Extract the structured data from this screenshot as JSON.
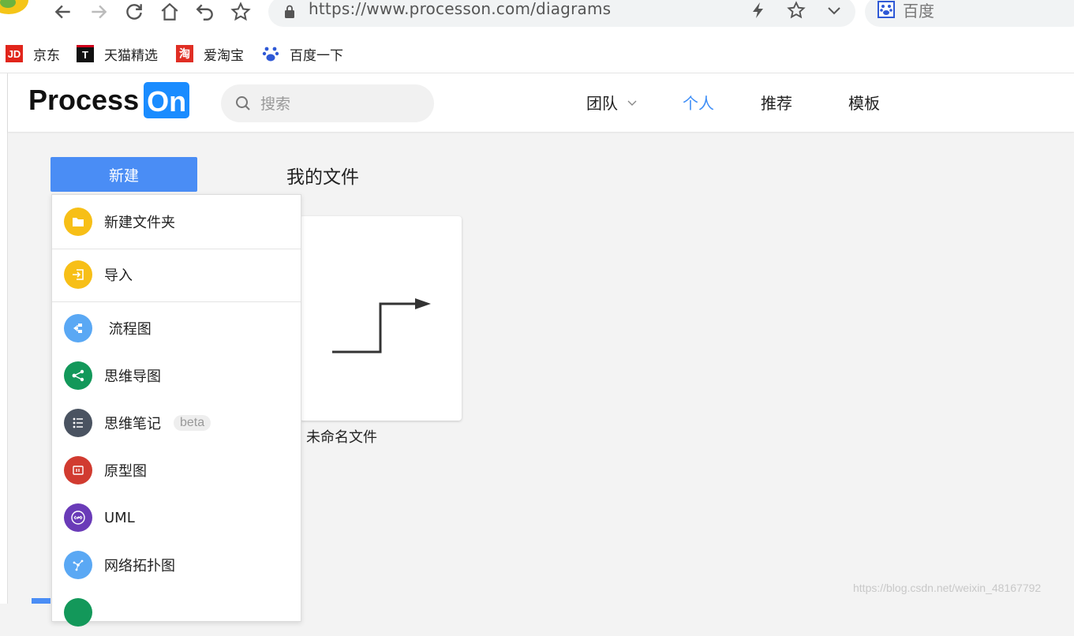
{
  "browser": {
    "url": "https://www.processon.com/diagrams",
    "search_engine_label": "百度"
  },
  "bookmarks": [
    {
      "label": "京东",
      "icon": "jd-icon",
      "icon_text": "JD",
      "color": "#e1251b"
    },
    {
      "label": "天猫精选",
      "icon": "tmall-icon",
      "icon_text": "T",
      "color": "#d0021b"
    },
    {
      "label": "爱淘宝",
      "icon": "aitaobao-icon",
      "icon_text": "淘",
      "color": "#e02e24"
    },
    {
      "label": "百度一下",
      "icon": "baidu-paw-icon",
      "icon_text": "",
      "color": "#2f59d6"
    }
  ],
  "app": {
    "logo_main": "Process",
    "logo_accent": "On",
    "brand_color": "#1a8cff",
    "search_placeholder": "搜索",
    "nav": [
      {
        "label": "团队",
        "has_dropdown": true,
        "active": false
      },
      {
        "label": "个人",
        "has_dropdown": false,
        "active": true
      },
      {
        "label": "推荐",
        "has_dropdown": false,
        "active": false
      },
      {
        "label": "模板",
        "has_dropdown": false,
        "active": false
      }
    ]
  },
  "main": {
    "new_button_label": "新建",
    "section_title": "我的文件",
    "files": [
      {
        "name": "未命名文件"
      }
    ]
  },
  "new_menu": {
    "items": [
      {
        "label": "新建文件夹",
        "icon": "folder-icon",
        "color": "#f7bf17"
      },
      {
        "label": "导入",
        "icon": "import-icon",
        "color": "#f7bf17"
      },
      {
        "label": " 流程图",
        "icon": "flowchart-icon",
        "color": "#5aa8f4"
      },
      {
        "label": "思维导图",
        "icon": "mindmap-icon",
        "color": "#13985a"
      },
      {
        "label": "思维笔记",
        "icon": "notes-icon",
        "color": "#4a5361",
        "badge": "beta"
      },
      {
        "label": "原型图",
        "icon": "prototype-icon",
        "color": "#d13b30"
      },
      {
        "label": "UML",
        "icon": "uml-icon",
        "color": "#6a3bb8"
      },
      {
        "label": "网络拓扑图",
        "icon": "network-icon",
        "color": "#5aa8f4"
      }
    ]
  },
  "watermark": "https://blog.csdn.net/weixin_48167792"
}
